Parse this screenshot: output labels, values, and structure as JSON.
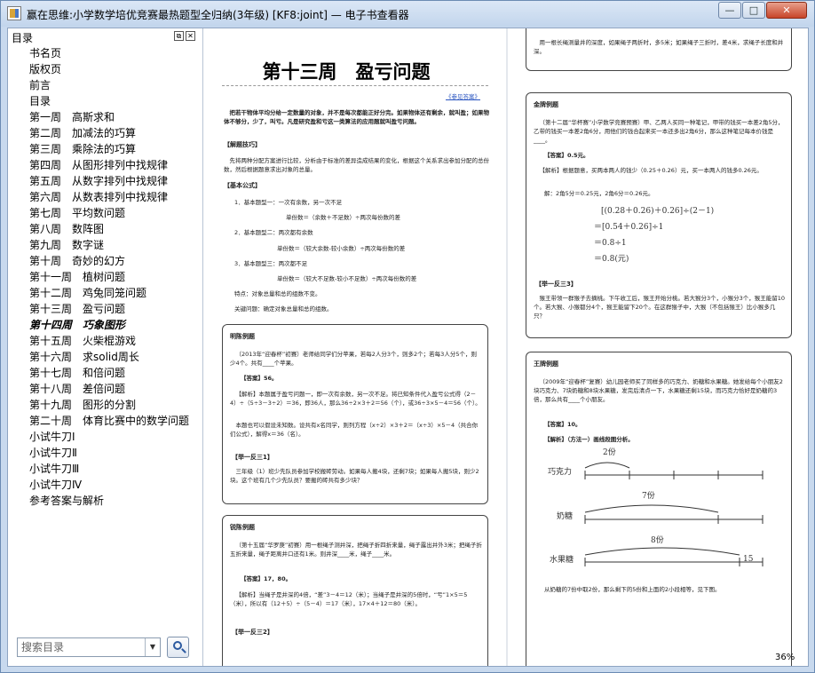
{
  "window": {
    "title": "赢在思维:小学数学培优竞赛最热题型全归纳(3年级) [KF8:joint] — 电子书查看器",
    "buttons": {
      "minimize": "—",
      "maximize": "□",
      "close": "✕"
    }
  },
  "sidebar": {
    "title": "目录",
    "pin_label": "⧉",
    "close_label": "✕",
    "items": [
      "书名页",
      "版权页",
      "前言",
      "目录",
      "第一周　高斯求和",
      "第二周　加减法的巧算",
      "第三周　乘除法的巧算",
      "第四周　从图形排列中找规律",
      "第五周　从数字排列中找规律",
      "第六周　从数表排列中找规律",
      "第七周　平均数问题",
      "第八周　数阵图",
      "第九周　数字谜",
      "第十周　奇妙的幻方",
      "第十一周　植树问题",
      "第十二周　鸡兔同笼问题",
      "第十三周　盈亏问题",
      "第十四周　巧象图形",
      "第十五周　火柴棍游戏",
      "第十六周　求solid周长",
      "第十七周　和倍问题",
      "第十八周　差倍问题",
      "第十九周　图形的分割",
      "第二十周　体育比赛中的数学问题",
      "小试牛刀Ⅰ",
      "小试牛刀Ⅱ",
      "小试牛刀Ⅲ",
      "小试牛刀Ⅳ",
      "参考答案与解析"
    ],
    "active_index": 17,
    "search": {
      "placeholder": "搜索目录",
      "value": ""
    }
  },
  "viewer": {
    "zoom": "36%",
    "left_page": {
      "title": "第十三周　盈亏问题",
      "ref_link": "《参见答案》",
      "intro": "把若干物体平均分给一定数量的对象，并不是每次都能正好分完。如果物体还有剩余，就叫盈；如果物体不够分，少了，叫亏。凡是研究盈和亏这一类算法的应用题就叫盈亏问题。",
      "tips_heading": "【解题技巧】",
      "tips_text": "先将两种分配方案进行比较，分析由于标准的差异造成结果的变化，根据这个关系求出参加分配的总份数，然后根据题意求出对象的总量。",
      "formula_heading": "【基本公式】",
      "formulas": [
        "1．基本题型一：一次有余数，另一次不足",
        "单份数＝（余数＋不足数）÷两次每份数的差",
        "2．基本题型二：两次都有余数",
        "单份数＝（较大余数-较小余数）÷两次每份数的差",
        "3．基本题型三：两次都不足",
        "单份数＝（较大不足数-较小不足数）÷两次每份数的差"
      ],
      "note": "特点：对象总量和总的组数不变。",
      "key": "关键问题：确定对象总量和总的组数。",
      "box1": {
        "title": "明陈例题",
        "problem": "（2013年“迎春杯”初赛）老师给同学们分苹果，若每2人分3个，则多2个；若每3人分5个，则少4个。共有____个苹果。",
        "answer": "【答案】56。",
        "analysis": "【解析】本题属于盈亏问题一，即一次有余数，另一次不足。将已知条件代入盈亏公式得（2－4）÷（5÷3－3÷2）＝36，即36人，那么36÷2×3＋2＝56（个），或36÷3×5－4＝56（个）。",
        "alt": "本题也可以假设未知数。设共有x名同学，则列方程（x÷2）×3＋2＝（x÷3）×5－4（共合你们公式），解得x＝36（名）。",
        "practice_heading": "【举一反三1】",
        "practice": "三年级（1）班少先队员参加学校搬砖劳动。如果每人搬4块，还剩7块；如果每人搬5块，则少2块。这个班有几个少先队员？要搬的砖共有多少块？"
      },
      "box2": {
        "title": "锐陈例题",
        "problem": "（第十五届“华罗庚”初赛）用一根绳子测井深，把绳子折四折来量，绳子露出井外3米；把绳子折五折来量，绳子距离井口还有1米。则井深____米，绳子____米。",
        "answer": "【答案】17，80。",
        "analysis": "【解析】当绳子是井深的4倍，“差”3－4＝12（米）；当绳子是井深的5倍时，“亏”1×5＝5（米），所以有（12＋5）÷（5－4）＝17（米），17×4＋12＝80（米）。",
        "practice_heading": "【举一反三2】"
      }
    },
    "right_page": {
      "top_text": "用一根长绳测量井的深度，如果绳子两折时，多5米；如果绳子三折时，差4米，求绳子长度和井深。",
      "box1": {
        "title": "金牌例题",
        "problem": "（第十二届“华杯赛”小学数学竞赛预赛）甲、乙两人买同一种笔记，甲带的钱买一本差2角5分，乙带的钱买一本差2角6分，用他们的钱合起来买一本还多出2角6分，那么这种笔记每本价钱是____。",
        "answer": "【答案】0.5元。",
        "analysis": "【解析】根据题意，买两本两人的钱少（0.25＋0.26）元，买一本两人的钱多0.26元。",
        "convert": "解：2角5分＝0.25元，2角6分＝0.26元。",
        "math_lines": [
          "[(0.28＋0.26)＋0.26]÷(2－1)",
          "＝[0.54＋0.26]÷1",
          "＝0.8÷1",
          "＝0.8(元)"
        ],
        "practice_heading": "【举一反三3】",
        "practice": "猴王带领一群猴子去摘桃。下午收工后，猴王开始分桃。若大猴分3个，小猴分3个，猴王能留10个。若大猴、小猴都分4个，猴王能留下20个。在这群猴子中，大猴（不包括猴王）比小猴多几只？"
      },
      "box2": {
        "title": "王牌例题",
        "problem": "（2009年“迎春杯”复赛）幼儿园老师买了同样多的巧克力、奶糖和水果糖。她发给每个小朋友2块巧克力、7块奶糖和8块水果糖，发完后清点一下，水果糖还剩15块，而巧克力恰好是奶糖的3倍，那么共有____个小朋友。",
        "answer": "【答案】10。",
        "analysis": "【解析】（方法一）画线段图分析。",
        "seg_rows": [
          {
            "label": "巧克力",
            "mark": "2份"
          },
          {
            "label": "奶糖",
            "mark": "7份"
          },
          {
            "label": "水果糖",
            "mark": "8份",
            "extra": "15"
          }
        ],
        "conclusion": "从奶糖的7份中取2份，那么剩下的5份和上面的2小段相等，见下图。"
      }
    }
  }
}
